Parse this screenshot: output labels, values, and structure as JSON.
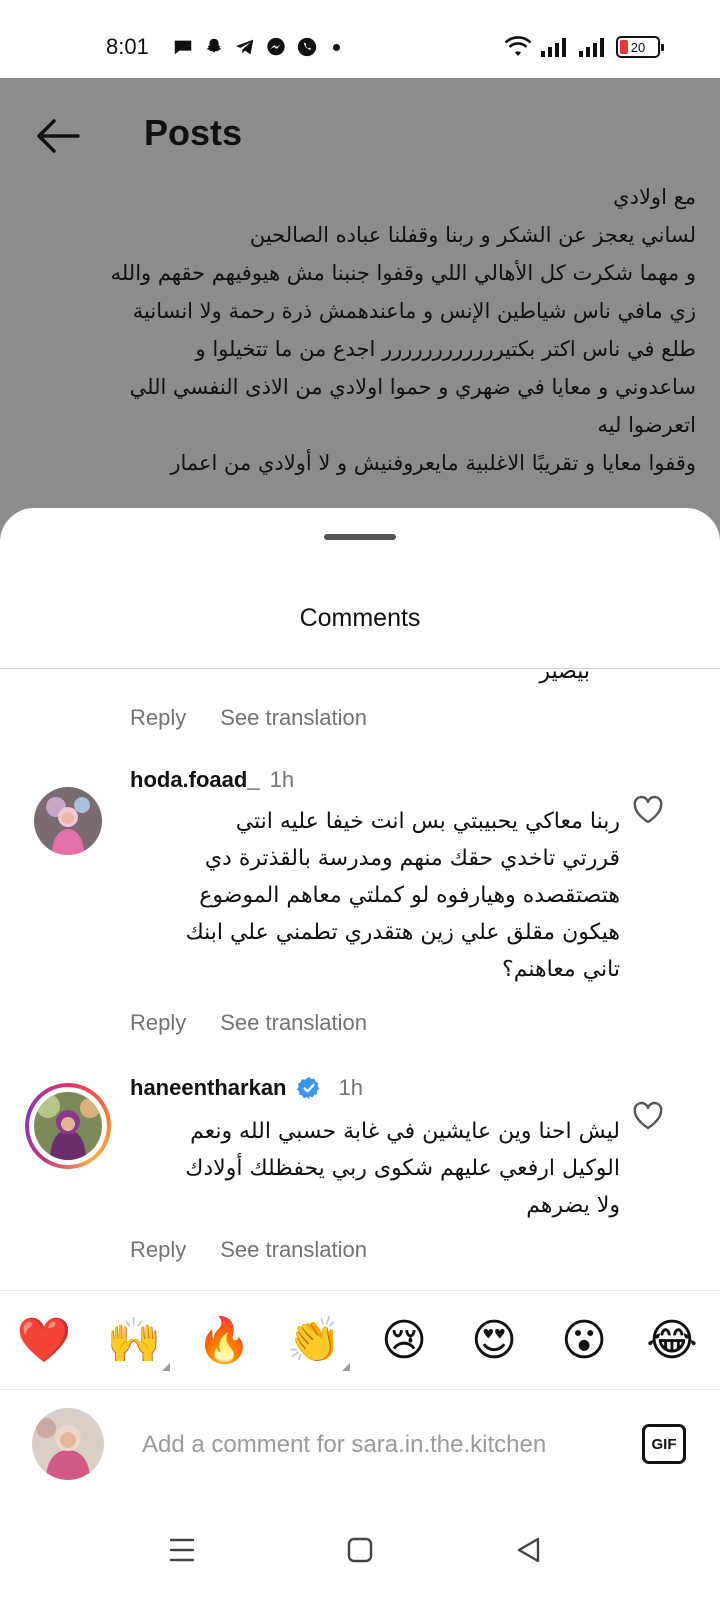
{
  "status_bar": {
    "time": "8:01",
    "battery_percent": 20,
    "battery_label": "20"
  },
  "header": {
    "title": "Posts"
  },
  "post": {
    "lines": [
      "مع اولادي",
      "لساني يعجز عن الشكر و ربنا وقفلنا عباده الصالحين",
      "و مهما شكرت كل الأهالي اللي وقفوا جنبنا مش هيوفيهم حقهم والله",
      "زي مافي ناس شياطين الإنس و ماعندهمش ذرة رحمة ولا انسانية",
      "طلع في ناس اكتر بكتيرررررررررررر اجدع من ما تتخيلوا و",
      "ساعدوني و معايا في ضهري و حموا اولادي من الاذى النفسي اللي",
      "اتعرضوا ليه",
      "وقفوا معايا و تقريبًا الاغلبية مايعروفنيش و لا أولادي من اعمار"
    ]
  },
  "sheet": {
    "title": "Comments"
  },
  "comments": {
    "partial_line": "بيصير",
    "first_reply_label": "Reply",
    "first_translate_label": "See translation",
    "items": [
      {
        "username": "hoda.foaad_",
        "time": "1h",
        "verified": false,
        "lines": [
          "ربنا معاكي يحبيبتي بس انت خيفا عليه انتي",
          "قررتي تاخدي حقك منهم ومدرسة بالقذترة دي",
          "هتصتقصده وهيارفوه لو كملتي معاهم الموضوع",
          "هيكون مقلق علي زين  هتقدري تطمني علي ابنك",
          "تاني معاهنم؟"
        ],
        "reply_label": "Reply",
        "translate_label": "See translation"
      },
      {
        "username": "haneentharkan",
        "time": "1h",
        "verified": true,
        "lines": [
          "ليش احنا وين عايشين في غابة حسبي الله ونعم",
          "الوكيل ارفعي عليهم شكوى ربي يحفظلك أولادك",
          "ولا يضرهم"
        ],
        "reply_label": "Reply",
        "translate_label": "See translation"
      }
    ]
  },
  "reactions": [
    {
      "name": "heart",
      "glyph": "❤️"
    },
    {
      "name": "raising-hands",
      "glyph": "🙌"
    },
    {
      "name": "fire",
      "glyph": "🔥"
    },
    {
      "name": "clapping-hands",
      "glyph": "👏"
    },
    {
      "name": "crying-face",
      "glyph": "😢"
    },
    {
      "name": "heart-eyes",
      "glyph": "😍"
    },
    {
      "name": "surprised-face",
      "glyph": "😮"
    },
    {
      "name": "tears-of-joy",
      "glyph": "😂"
    }
  ],
  "composer": {
    "placeholder": "Add a comment for sara.in.the.kitchen",
    "gif_label": "GIF"
  },
  "colors": {
    "dim_overlay": "#8c8c8c",
    "verified_blue": "#3897f0",
    "battery_low": "#e53935",
    "secondary_text": "#737373"
  }
}
